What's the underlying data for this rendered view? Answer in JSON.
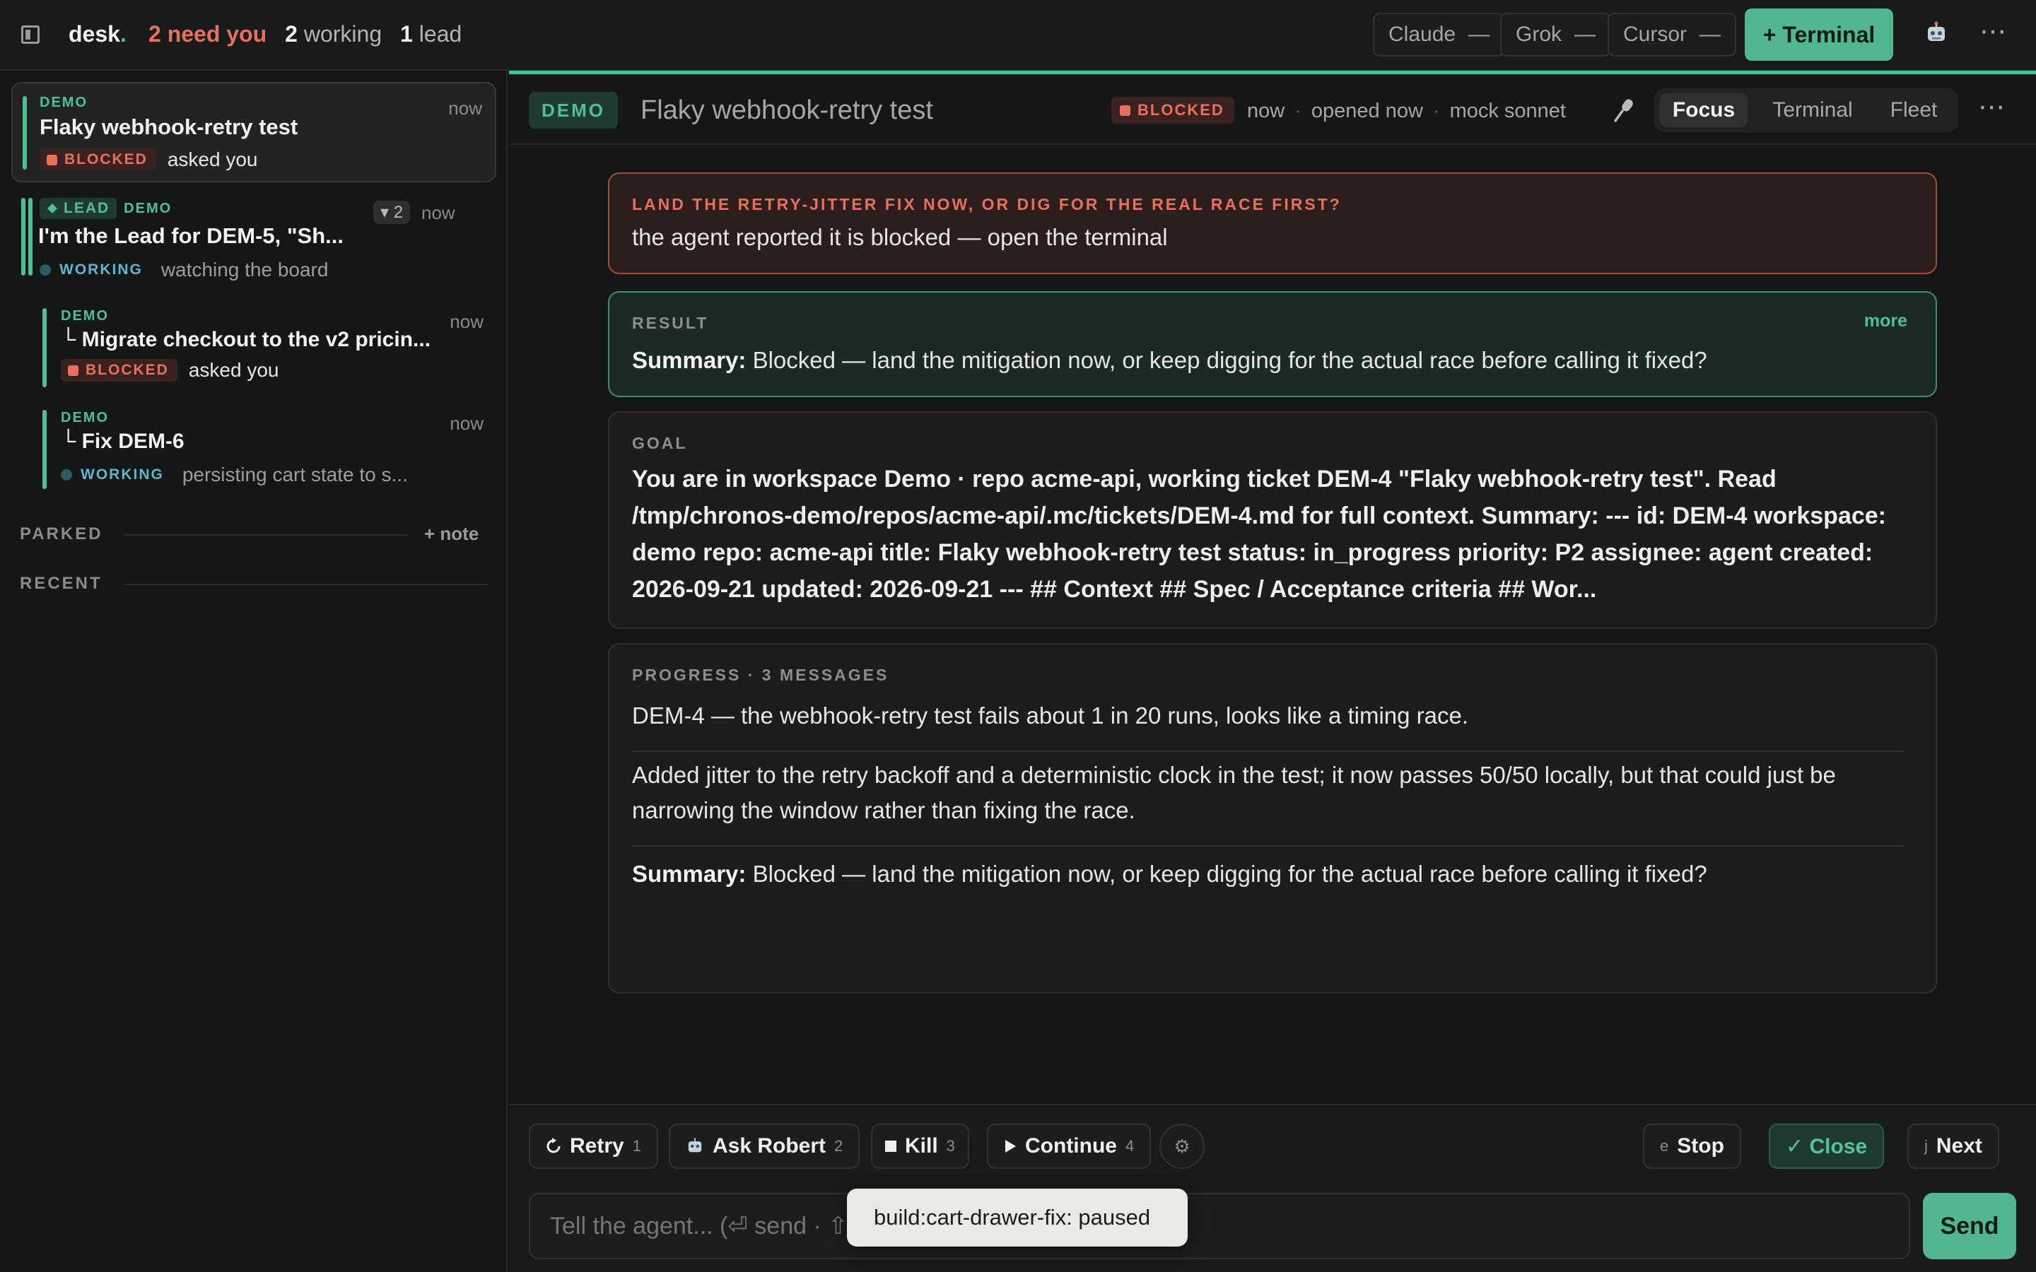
{
  "topbar": {
    "brand": "desk",
    "brand_dot": ".",
    "need_count": "2 need you",
    "working_num": "2",
    "working_lbl": "working",
    "lead_num": "1",
    "lead_lbl": "lead",
    "agents": [
      {
        "name": "Claude",
        "status": "—"
      },
      {
        "name": "Grok",
        "status": "—"
      },
      {
        "name": "Cursor",
        "status": "—"
      }
    ],
    "new_terminal": "+ Terminal",
    "more": "⋯"
  },
  "sidebar": {
    "items": [
      {
        "workspace": "DEMO",
        "title": "Flaky webhook-retry test",
        "time": "now",
        "status": "BLOCKED",
        "detail": "asked you"
      },
      {
        "role": "LEAD",
        "workspace": "DEMO",
        "title": "I'm the Lead for DEM-5, \"Sh...",
        "count": "▾ 2",
        "time": "now",
        "status": "WORKING",
        "detail": "watching the board"
      },
      {
        "workspace": "DEMO",
        "title": "└ Migrate checkout to the v2 pricin...",
        "time": "now",
        "status": "BLOCKED",
        "detail": "asked you"
      },
      {
        "workspace": "DEMO",
        "title": "└ Fix DEM-6",
        "time": "now",
        "status": "WORKING",
        "detail": "persisting cart state to s..."
      }
    ],
    "parked_label": "PARKED",
    "add_note": "+ note",
    "recent_label": "RECENT"
  },
  "header": {
    "workspace": "DEMO",
    "title": "Flaky webhook-retry test",
    "status": "BLOCKED",
    "time": "now",
    "opened": "opened now",
    "model": "mock sonnet",
    "sep": "·",
    "tabs": [
      "Focus",
      "Terminal",
      "Fleet"
    ],
    "more": "⋯"
  },
  "blocked_panel": {
    "label": "LAND THE RETRY-JITTER FIX NOW, OR DIG FOR THE REAL RACE FIRST?",
    "text": "the agent reported it is blocked — open the terminal"
  },
  "result_panel": {
    "label": "RESULT",
    "more": "more",
    "summary_label": "Summary:",
    "summary": "Blocked — land the mitigation now, or keep digging for the actual race before calling it fixed?"
  },
  "goal_panel": {
    "label": "GOAL",
    "text": "You are in workspace Demo · repo acme-api, working ticket DEM-4 \"Flaky webhook-retry test\". Read /tmp/chronos-demo/repos/acme-api/.mc/tickets/DEM-4.md for full context. Summary: --- id: DEM-4 workspace: demo repo: acme-api title: Flaky webhook-retry test status: in_progress priority: P2 assignee: agent created: 2026-09-21 updated: 2026-09-21 --- ## Context ## Spec / Acceptance criteria ## Wor..."
  },
  "progress_panel": {
    "label": "PROGRESS · 3 MESSAGES",
    "messages": [
      "DEM-4 — the webhook-retry test fails about 1 in 20 runs, looks like a timing race.",
      "Added jitter to the retry backoff and a deterministic clock in the test; it now passes 50/50 locally, but that could just be narrowing the window rather than fixing the race."
    ],
    "summary_label": "Summary:",
    "summary": "Blocked — land the mitigation now, or keep digging for the actual race before calling it fixed?"
  },
  "actions": {
    "retry": {
      "label": "Retry",
      "key": "1"
    },
    "ask": {
      "label": "Ask Robert",
      "key": "2"
    },
    "kill": {
      "label": "Kill",
      "key": "3"
    },
    "continue": {
      "label": "Continue",
      "key": "4"
    },
    "stop": {
      "label": "Stop",
      "key": "e"
    },
    "close": {
      "label": "✓ Close"
    },
    "next": {
      "label": "Next",
      "key": "j"
    },
    "input_placeholder": "Tell the agent... (⏎ send · ⇧",
    "send": "Send"
  },
  "toast": "build:cart-drawer-fix: paused",
  "colors": {
    "accent": "#4fbf95",
    "blocked": "#e8705c",
    "working": "#5fb4cf",
    "background": "#151716"
  }
}
